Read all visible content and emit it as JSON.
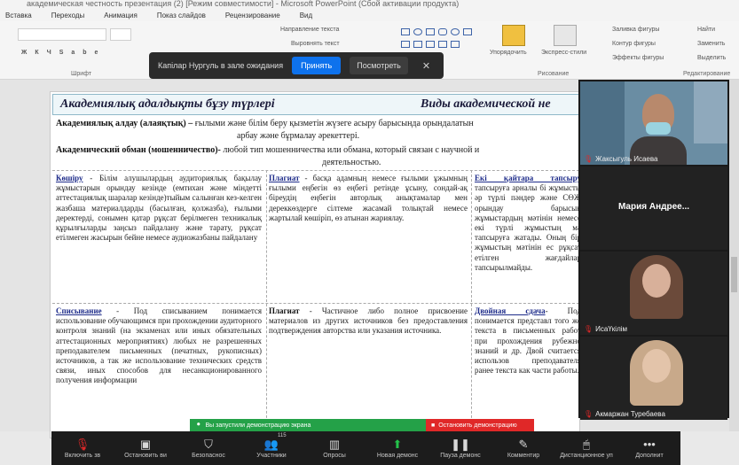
{
  "window": {
    "title": "академическая честность презентация (2) [Режим совместимости] - Microsoft PowerPoint (Сбой активации продукта)"
  },
  "menu": [
    "Вставка",
    "Переходы",
    "Анимация",
    "Показ слайдов",
    "Рецензирование",
    "Вид"
  ],
  "ribbon": {
    "font_group_label": "Шрифт",
    "drawing_group_label": "Рисование",
    "editing_group_label": "Редактирование",
    "text_direction": "Направление текста",
    "align_text": "Выровнять текст",
    "arrange": "Упорядочить",
    "quick_styles": "Экспресс-стили",
    "shape_fill": "Заливка фигуры",
    "shape_outline": "Контур фигуры",
    "shape_effects": "Эффекты фигуры",
    "find": "Найти",
    "replace": "Заменить",
    "select": "Выделить"
  },
  "notification": {
    "text": "Капілар Нургуль в зале ожидания",
    "accept": "Принять",
    "view": "Посмотреть"
  },
  "slide": {
    "title_left": "Академиялық адалдықты бұзу түрлері",
    "title_right": "Виды академической не",
    "def1_head": "Академиялық алдау (алаяқтық) –",
    "def1_body": " ғылыми және білім беру қызметін жүзеге асыру барысында орындалатын",
    "def1_cont": "арбау және бұрмалау әрекеттері.",
    "def2_head": "Академический обман (мошенничество)-",
    "def2_body": " любой тип мошенничества или обмана, который связан с научной и",
    "def2_cont": "деятельностью.",
    "col1_key": "Көшіру",
    "col1_text": " - Білім алушылардың аудиториялық бақылау жұмыстарын орындау кезінде (емтихан және міндетті аттестациялық шаралар кезінде)тыйым салынған кез-келген жазбаша материалдарды (басылған, қолжазба), ғылыми деректерді, сонымен қатар рұқсат берілмеген техникалық құрылғыларды заңсыз пайдалану және тарату, рұқсат етілмеген жасырын бейне немесе аудиожазбаны пайдалану",
    "col2_key": "Плагиат",
    "col2_text": " - басқа адамның немесе ғылыми ұжымның ғылыми еңбегін өз еңбегі ретінде ұсыну, сондай-ақ біреудің еңбегін авторлық анықтамалар мен дереккөздерге сілтеме жасамай толықтай немесе жартылай көшіріп, өз атынан жариялау.",
    "col3_key": "Екі қайтара тапсыру",
    "col3_text": " тапсыруға арналы бі жұмысты әр түрлі пәндер және СӨЖ орындау барысын жұмыстардың мәтінін немесе екі түрлі жұмыстың мә тапсыруға жатады. Оның бір жұмыстың мәтінін ес рұқсат етілген жағдайлар тапсырылмайды.",
    "col4_key": "Списывание",
    "col4_text": " - Под списыванием понимается использование обучающимся при прохождении аудиторного контроля знаний (на экзаменах или иных обязательных аттестационных мероприятиях) любых не разрешенных преподавателем письменных (печатных, рукописных) источников, а так же использование технических средств связи, иных способов для несанкционированного получения информации",
    "col5_key": "Плагиат",
    "col5_text": " - Частичное либо полное присвоение материалов из других источников без предоставления подтверждения авторства или указания источника.",
    "col6_key": "Двойная сдача",
    "col6_text": "- Под понимается представл того же текста в письменных работ при прохождения рубежно знаний и др. Двой считается использов преподавателя ранее текста как части работы."
  },
  "participants": [
    {
      "name": "Жаксыгуль Исаева",
      "muted": true,
      "video": true
    },
    {
      "name": "Мария Андрее...",
      "muted": false,
      "video": false
    },
    {
      "name": "ИсаҮкілім",
      "muted": true,
      "video": true
    },
    {
      "name": "Акмаржан Туребаева",
      "muted": true,
      "video": true
    }
  ],
  "share_bar": {
    "status": "Вы запустили демонстрацию экрана",
    "stop": "Остановить демонстрацию"
  },
  "toolbar": [
    {
      "label": "Включить зв",
      "icon": "mic-off-icon"
    },
    {
      "label": "Остановить ви",
      "icon": "video-icon"
    },
    {
      "label": "Безопаснос",
      "icon": "shield-icon"
    },
    {
      "label": "Участники",
      "icon": "participants-icon",
      "count": "115"
    },
    {
      "label": "Опросы",
      "icon": "polls-icon"
    },
    {
      "label": "Новая демонс",
      "icon": "share-screen-icon"
    },
    {
      "label": "Пауза демонс",
      "icon": "pause-icon"
    },
    {
      "label": "Комментир",
      "icon": "annotate-icon"
    },
    {
      "label": "Дистанционное уп",
      "icon": "remote-control-icon"
    },
    {
      "label": "Дополнит",
      "icon": "more-icon"
    }
  ]
}
